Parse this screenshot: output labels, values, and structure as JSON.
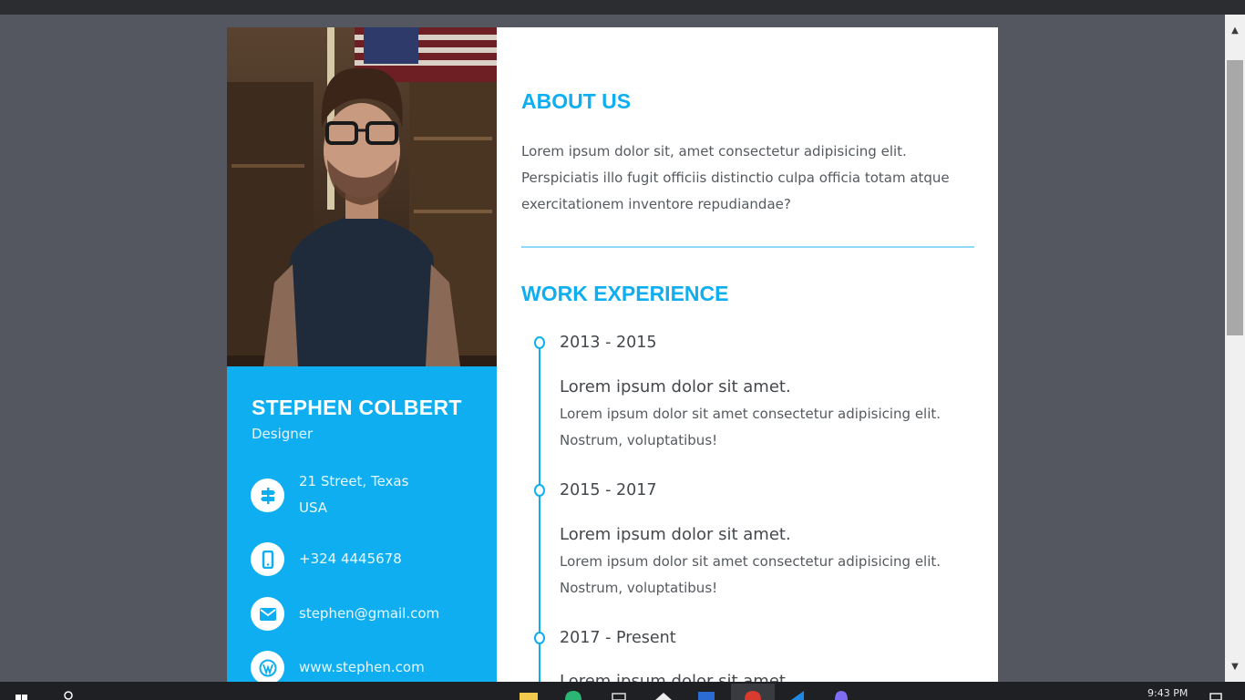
{
  "resume": {
    "name": "STEPHEN COLBERT",
    "role": "Designer",
    "contacts": {
      "address_line1": "21 Street, Texas",
      "address_line2": "USA",
      "phone": "+324 4445678",
      "email": "stephen@gmail.com",
      "website": "www.stephen.com"
    },
    "about": {
      "heading": "ABOUT US",
      "text": "Lorem ipsum dolor sit, amet consectetur adipisicing elit. Perspiciatis illo fugit officiis distinctio culpa officia totam atque exercitationem inventore repudiandae?"
    },
    "work": {
      "heading": "WORK EXPERIENCE",
      "items": [
        {
          "years": "2013 - 2015",
          "title": "Lorem ipsum dolor sit amet.",
          "desc_line1": "Lorem ipsum dolor sit amet consectetur adipisicing elit.",
          "desc_line2": "Nostrum, voluptatibus!"
        },
        {
          "years": "2015 - 2017",
          "title": "Lorem ipsum dolor sit amet.",
          "desc_line1": "Lorem ipsum dolor sit amet consectetur adipisicing elit.",
          "desc_line2": "Nostrum, voluptatibus!"
        },
        {
          "years": "2017 - Present",
          "title": "Lorem ipsum dolor sit amet."
        }
      ]
    }
  },
  "taskbar": {
    "clock": "9:43 PM"
  },
  "colors": {
    "accent": "#0eaef0",
    "page_background": "#54575f",
    "taskbar": "#1f2023"
  },
  "icons": {
    "address": "signpost-icon",
    "phone": "mobile-phone-icon",
    "email": "envelope-icon",
    "website": "wordpress-icon"
  }
}
